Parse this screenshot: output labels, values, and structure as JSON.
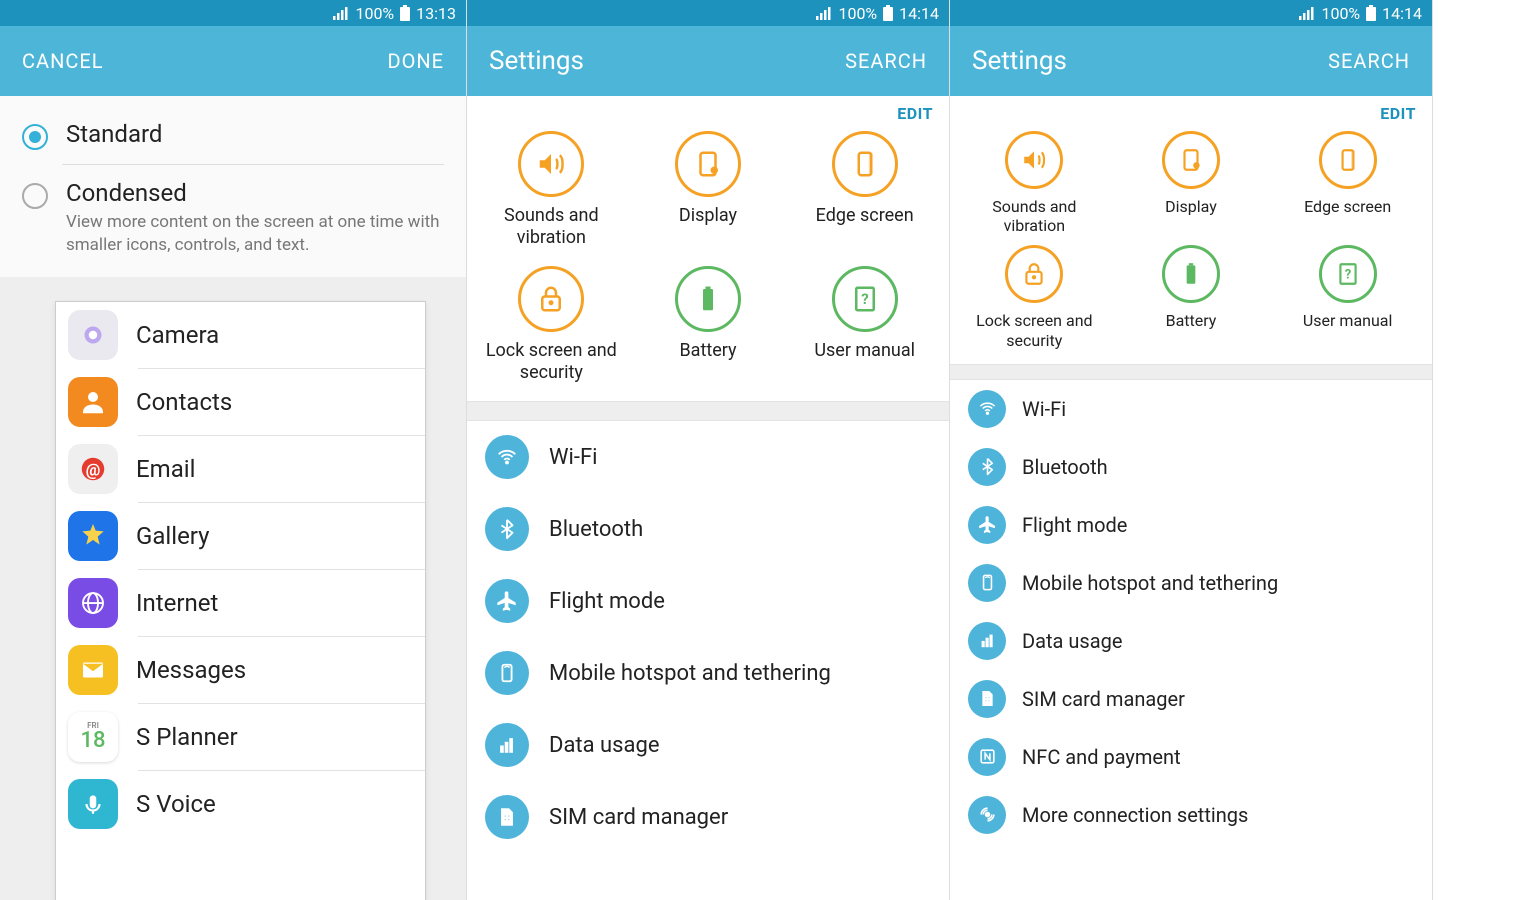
{
  "panel1": {
    "status": {
      "battery_pct": "100%",
      "time": "13:13"
    },
    "actionbar": {
      "cancel": "CANCEL",
      "done": "DONE"
    },
    "options": [
      {
        "title": "Standard",
        "selected": true
      },
      {
        "title": "Condensed",
        "subtitle": "View more content on the screen at one time with smaller icons, controls, and text.",
        "selected": false
      }
    ],
    "apps": [
      {
        "label": "Camera",
        "icon": "camera",
        "bg": "#e9e9ef",
        "fg": "#9b8be0"
      },
      {
        "label": "Contacts",
        "icon": "contacts",
        "bg": "#f28a1f",
        "fg": "#ffffff"
      },
      {
        "label": "Email",
        "icon": "email",
        "bg": "#efefef",
        "fg": "#e43c2e"
      },
      {
        "label": "Gallery",
        "icon": "gallery",
        "bg": "#1f74e8",
        "fg": "#f7d24a"
      },
      {
        "label": "Internet",
        "icon": "internet",
        "bg": "#7a4ce6",
        "fg": "#ffffff"
      },
      {
        "label": "Messages",
        "icon": "messages",
        "bg": "#f6c022",
        "fg": "#ffffff"
      },
      {
        "label": "S Planner",
        "icon": "splanner",
        "bg": "#f3f3f3",
        "fg": "#5db862"
      },
      {
        "label": "S Voice",
        "icon": "svoice",
        "bg": "#2fb7d1",
        "fg": "#ffffff"
      }
    ],
    "app_extra": {
      "splanner_day": "18",
      "splanner_weekday": "FRI"
    }
  },
  "panel2": {
    "status": {
      "battery_pct": "100%",
      "time": "14:14"
    },
    "actionbar": {
      "title": "Settings",
      "search": "SEARCH"
    },
    "edit_label": "EDIT",
    "quick": [
      {
        "label": "Sounds and vibration",
        "icon": "sound",
        "color": "orange"
      },
      {
        "label": "Display",
        "icon": "display",
        "color": "orange"
      },
      {
        "label": "Edge screen",
        "icon": "edge",
        "color": "orange"
      },
      {
        "label": "Lock screen and security",
        "icon": "lock",
        "color": "orange"
      },
      {
        "label": "Battery",
        "icon": "battery",
        "color": "green"
      },
      {
        "label": "User manual",
        "icon": "manual",
        "color": "green"
      }
    ],
    "settings": [
      {
        "label": "Wi-Fi",
        "icon": "wifi"
      },
      {
        "label": "Bluetooth",
        "icon": "bluetooth"
      },
      {
        "label": "Flight mode",
        "icon": "flight"
      },
      {
        "label": "Mobile hotspot and tethering",
        "icon": "hotspot"
      },
      {
        "label": "Data usage",
        "icon": "data"
      },
      {
        "label": "SIM card manager",
        "icon": "sim"
      }
    ]
  },
  "panel3": {
    "status": {
      "battery_pct": "100%",
      "time": "14:14"
    },
    "actionbar": {
      "title": "Settings",
      "search": "SEARCH"
    },
    "edit_label": "EDIT",
    "quick": [
      {
        "label": "Sounds and vibration",
        "icon": "sound",
        "color": "orange"
      },
      {
        "label": "Display",
        "icon": "display",
        "color": "orange"
      },
      {
        "label": "Edge screen",
        "icon": "edge",
        "color": "orange"
      },
      {
        "label": "Lock screen and security",
        "icon": "lock",
        "color": "orange"
      },
      {
        "label": "Battery",
        "icon": "battery",
        "color": "green"
      },
      {
        "label": "User manual",
        "icon": "manual",
        "color": "green"
      }
    ],
    "settings": [
      {
        "label": "Wi-Fi",
        "icon": "wifi"
      },
      {
        "label": "Bluetooth",
        "icon": "bluetooth"
      },
      {
        "label": "Flight mode",
        "icon": "flight"
      },
      {
        "label": "Mobile hotspot and tethering",
        "icon": "hotspot"
      },
      {
        "label": "Data usage",
        "icon": "data"
      },
      {
        "label": "SIM card manager",
        "icon": "sim"
      },
      {
        "label": "NFC and payment",
        "icon": "nfc"
      },
      {
        "label": "More connection settings",
        "icon": "more"
      }
    ]
  }
}
